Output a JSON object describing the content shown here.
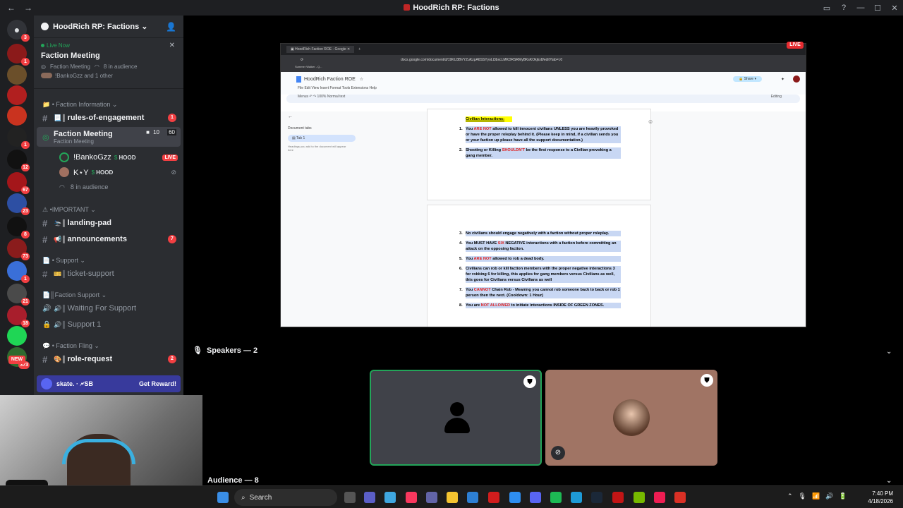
{
  "window": {
    "title": "HoodRich RP: Factions"
  },
  "server": {
    "name": "HoodRich RP: Factions"
  },
  "live_card": {
    "status": "Live Now",
    "title": "Faction Meeting",
    "channel": "Faction Meeting",
    "audience": "8 in audience",
    "host": "!BankoGzz and 1 other"
  },
  "servers": [
    {
      "badge": "3",
      "color": "#5865f2"
    },
    {
      "badge": "1",
      "color": "#8b1a1a"
    },
    {
      "badge": "",
      "color": "#6b4f2a"
    },
    {
      "badge": "",
      "color": "#b11f1f"
    },
    {
      "badge": "",
      "color": "#c9331f"
    },
    {
      "badge": "1",
      "color": "#222"
    },
    {
      "badge": "12",
      "color": "#111"
    },
    {
      "badge": "67",
      "color": "#a4161a"
    },
    {
      "badge": "23",
      "color": "#2d4fa3"
    },
    {
      "badge": "8",
      "color": "#111"
    },
    {
      "badge": "73",
      "color": "#8a1c1c"
    },
    {
      "badge": "1",
      "color": "#3a6fd8"
    },
    {
      "badge": "21",
      "color": "#4a4a4a"
    },
    {
      "badge": "18",
      "color": "#a81e2c"
    },
    {
      "badge": "",
      "color": "#1fd655"
    },
    {
      "badge": "373",
      "color": "#2f6b2f"
    }
  ],
  "new_label": "NEW",
  "channels": {
    "cat_faction_info": "Faction Information",
    "rules": "rules-of-engagement",
    "rules_badge": "1",
    "voice_meeting": "Faction Meeting",
    "voice_meeting_sub": "Faction Meeting",
    "voice_meeting_count_a": "10",
    "voice_meeting_count_b": "60",
    "member1": "!BankoGzz",
    "member1_tag": "HOOD",
    "member1_live": "LIVE",
    "member2": "K⋆Y",
    "member2_tag": "HOOD",
    "audience": "8 in audience",
    "cat_important": "IMPORTANT",
    "landing": "landing-pad",
    "announcements": "announcements",
    "announcements_badge": "7",
    "cat_support": "Support",
    "ticket": "ticket-support",
    "cat_faction_support": "Faction Support",
    "waiting": "Waiting For Support",
    "support1": "Support 1",
    "cat_faction_fling": "Faction Fling",
    "role_request": "role-request",
    "role_badge": "2"
  },
  "promo": {
    "brand": "skate. · 🗲SB",
    "button": "Get Reward!"
  },
  "share": {
    "live": "LIVE",
    "tab": "HoodRich Faction ROE - Google",
    "url": "docs.google.com/document/d/19KU3BVYZuKzpA6SSYyoLt3bxcLMKDRSRMyBKsKOkjkx8/edit?tab=t.0",
    "bookmark": "Summer Walker - Q...",
    "doc_title": "HoodRich Faction ROE",
    "menu": "File   Edit   View   Insert   Format   Tools   Extensions   Help",
    "toolbar": "Menus   ↶ ↷   100%   Normal text",
    "editing": "Editing",
    "share_btn": "Share",
    "doc_tabs": "Document tabs",
    "tab1": "Tab 1",
    "outline_hint": "Headings you add to the document will appear here",
    "heading": "Civilian Interactions:",
    "rules": [
      {
        "n": "1.",
        "pre": "You ",
        "red": "ARE NOT",
        "post": " allowed to kill innocent civilians UNLESS you are heavily provoked or have the proper roleplay behind it. (Please keep in mind, if a civilian sends you or your faction up please have all the support documentation.)"
      },
      {
        "n": "2.",
        "pre": "Shooting or Killing ",
        "red": "SHOULDN'T",
        "post": " be the first response to a Civilian provoking a gang member."
      },
      {
        "n": "3.",
        "pre": "No civilians should engage negatively with a faction without proper roleplay.",
        "red": "",
        "post": ""
      },
      {
        "n": "4.",
        "pre": "You MUST HAVE ",
        "red": "SIX",
        "post": " NEGATIVE interactions with a faction before committing an attack on the opposing faction."
      },
      {
        "n": "5.",
        "pre": "You ",
        "red": "ARE NOT",
        "post": " allowed to rob a dead body."
      },
      {
        "n": "6.",
        "pre": "Civilians can rob or kill faction members with the proper negative interactions 3 for robbing 6 for killing, this applies for gang members versus Civilians as well, this goes for Civilians versus Civilians as well",
        "red": "",
        "post": ""
      },
      {
        "n": "7.",
        "pre": "You ",
        "red": "CANNOT",
        "post": " Chain Rob - Meaning you cannot rob someone back to back or rob 1 person then the next. (Cooldown: 1 Hour)"
      },
      {
        "n": "8.",
        "pre": "You are ",
        "red": "NOT ALLOWED",
        "post": " to initiate interactions INSIDE OF GREEN ZONES."
      }
    ]
  },
  "stage": {
    "speakers": "Speakers — 2",
    "audience": "Audience — 8"
  },
  "taskbar": {
    "search": "Search",
    "time": "7:40 PM",
    "date": "4/18/2026"
  },
  "colors": {
    "rail": "#1e1f22",
    "sidebar": "#2b2d31",
    "accent": "#5865f2",
    "danger": "#f23f42",
    "speaking": "#23a559"
  }
}
